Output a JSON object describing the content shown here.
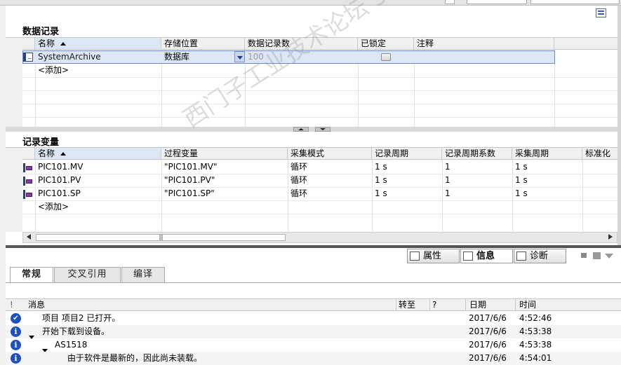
{
  "archives": {
    "title": "数据记录",
    "columns": [
      "名称",
      "存储位置",
      "数据记录数",
      "已锁定",
      "注释"
    ],
    "rows": [
      {
        "name": "SystemArchive",
        "location": "数据库",
        "count": "100",
        "locked": false,
        "comment": ""
      }
    ],
    "add_label": "<添加>"
  },
  "tags": {
    "title": "记录变量",
    "columns": [
      "名称",
      "过程变量",
      "采集模式",
      "记录周期",
      "记录周期系数",
      "采集周期",
      "标准化"
    ],
    "rows": [
      {
        "name": "PIC101.MV",
        "process_tag": "\"PIC101.MV\"",
        "mode": "循环",
        "log_cycle": "1 s",
        "factor": "1",
        "acq_cycle": "1 s"
      },
      {
        "name": "PIC101.PV",
        "process_tag": "\"PIC101.PV\"",
        "mode": "循环",
        "log_cycle": "1 s",
        "factor": "1",
        "acq_cycle": "1 s"
      },
      {
        "name": "PIC101.SP",
        "process_tag": "\"PIC101.SP\"",
        "mode": "循环",
        "log_cycle": "1 s",
        "factor": "1",
        "acq_cycle": "1 s"
      }
    ],
    "add_label": "<添加>",
    "scroll_thumb_glyph": "|||"
  },
  "inspector": {
    "tabs": [
      {
        "label": "属性",
        "icon": "properties-icon"
      },
      {
        "label": "信息",
        "icon": "info-icon"
      },
      {
        "label": "诊断",
        "icon": "diagnostics-icon"
      }
    ],
    "subtabs": [
      "常规",
      "交叉引用",
      "编译"
    ],
    "columns": {
      "flag": "!",
      "message": "消息",
      "goto": "转至",
      "help": "?",
      "date": "日期",
      "time": "时间"
    },
    "messages": [
      {
        "icon": "check-icon",
        "indent": 0,
        "expand": false,
        "text": "项目 项目2 已打开。",
        "date": "2017/6/6",
        "time": "4:52:46"
      },
      {
        "icon": "info-icon",
        "indent": 0,
        "expand": true,
        "text": "开始下载到设备。",
        "date": "2017/6/6",
        "time": "4:53:38"
      },
      {
        "icon": "info-icon",
        "indent": 1,
        "expand": true,
        "text": "AS1518",
        "date": "2017/6/6",
        "time": "4:53:38"
      },
      {
        "icon": "info-icon",
        "indent": 2,
        "expand": false,
        "text": "由于软件是最新的，因此尚未装载。",
        "date": "2017/6/6",
        "time": "4:54:01"
      }
    ],
    "info_glyph": "i"
  },
  "watermark": "西门子工业技术论坛 support.industry.siemens.com/cs",
  "colors": {
    "selection": "#dce6f4",
    "accent": "#1c4fbf",
    "header": "#f0f0f0"
  }
}
